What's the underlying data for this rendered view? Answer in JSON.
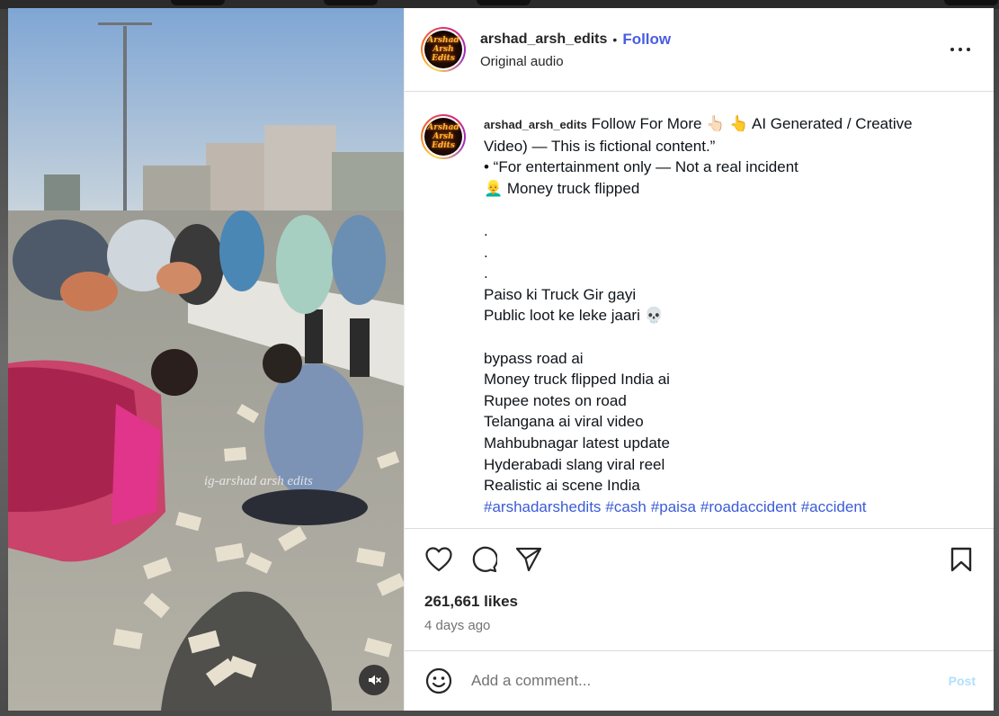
{
  "post": {
    "username": "arshad_arsh_edits",
    "separator": "•",
    "follow_label": "Follow",
    "audio": "Original audio",
    "avatar_logo_line1": "Arshad",
    "avatar_logo_line2": "Arsh Edits",
    "more_icon": "more-horizontal-icon"
  },
  "media": {
    "watermark": "ig-arshad arsh edits",
    "mute_icon": "volume-muted-icon"
  },
  "caption": {
    "username": "arshad_arsh_edits",
    "line1": " Follow For More 👆🏻 👆 AI Generated / Creative",
    "line2": "Video) — This is fictional content.”",
    "line3": "• “For entertainment only — Not a real incident",
    "line4": "👱‍♂️  Money truck flipped",
    "dot1": ".",
    "dot2": ".",
    "dot3": ".",
    "line5": "Paiso ki Truck Gir gayi",
    "line6": "Public loot ke leke jaari 💀",
    "kw1": "bypass road ai",
    "kw2": "Money truck flipped India ai",
    "kw3": "Rupee notes on road",
    "kw4": "Telangana ai viral video",
    "kw5": "Mahbubnagar latest update",
    "kw6": "Hyderabadi slang viral reel",
    "kw7": "Realistic ai scene India",
    "hashtags": [
      "#arshadarshedits",
      "#cash",
      "#paisa",
      "#roadaccident",
      "#accident"
    ]
  },
  "actions": {
    "like_icon": "heart-icon",
    "comment_icon": "comment-icon",
    "share_icon": "send-icon",
    "save_icon": "bookmark-icon",
    "likes": "261,661 likes",
    "time": "4 days ago"
  },
  "comment": {
    "emoji_icon": "emoji-icon",
    "placeholder": "Add a comment...",
    "post_label": "Post"
  },
  "colors": {
    "accent": "#4a5de0",
    "hashtag": "#3b5bd8",
    "post_disabled": "#b2dffc",
    "muted_text": "#737373"
  }
}
